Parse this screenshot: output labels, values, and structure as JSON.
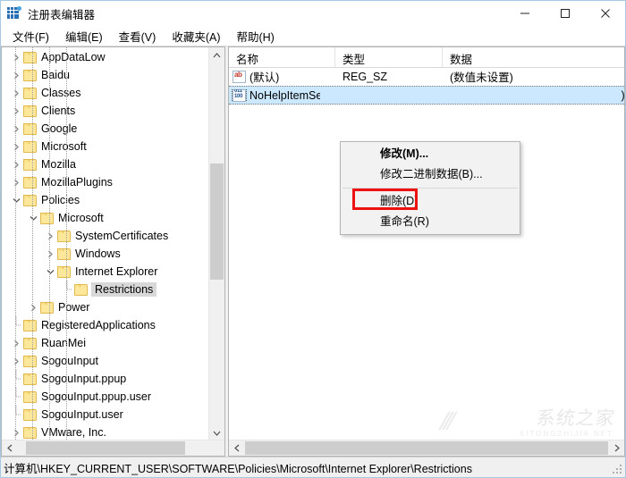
{
  "window": {
    "title": "注册表编辑器",
    "icon": "registry-editor-icon",
    "controls": {
      "minimize": "–",
      "maximize": "□",
      "close": "✕"
    }
  },
  "menubar": {
    "items": [
      {
        "label": "文件(F)",
        "name": "menu-file"
      },
      {
        "label": "编辑(E)",
        "name": "menu-edit"
      },
      {
        "label": "查看(V)",
        "name": "menu-view"
      },
      {
        "label": "收藏夹(A)",
        "name": "menu-favorites"
      },
      {
        "label": "帮助(H)",
        "name": "menu-help"
      }
    ]
  },
  "tree": {
    "items": [
      {
        "label": "AppDataLow",
        "indent": 1,
        "state": "collapsed",
        "selected": false
      },
      {
        "label": "Baidu",
        "indent": 1,
        "state": "collapsed",
        "selected": false
      },
      {
        "label": "Classes",
        "indent": 1,
        "state": "collapsed",
        "selected": false
      },
      {
        "label": "Clients",
        "indent": 1,
        "state": "collapsed",
        "selected": false
      },
      {
        "label": "Google",
        "indent": 1,
        "state": "collapsed",
        "selected": false
      },
      {
        "label": "Microsoft",
        "indent": 1,
        "state": "collapsed",
        "selected": false
      },
      {
        "label": "Mozilla",
        "indent": 1,
        "state": "collapsed",
        "selected": false
      },
      {
        "label": "MozillaPlugins",
        "indent": 1,
        "state": "collapsed",
        "selected": false
      },
      {
        "label": "Policies",
        "indent": 1,
        "state": "expanded",
        "selected": false
      },
      {
        "label": "Microsoft",
        "indent": 2,
        "state": "expanded",
        "selected": false
      },
      {
        "label": "SystemCertificates",
        "indent": 3,
        "state": "collapsed",
        "selected": false
      },
      {
        "label": "Windows",
        "indent": 3,
        "state": "collapsed",
        "selected": false
      },
      {
        "label": "Internet Explorer",
        "indent": 3,
        "state": "expanded",
        "selected": false
      },
      {
        "label": "Restrictions",
        "indent": 4,
        "state": "leaf",
        "selected": true
      },
      {
        "label": "Power",
        "indent": 2,
        "state": "collapsed",
        "selected": false
      },
      {
        "label": "RegisteredApplications",
        "indent": 1,
        "state": "leaf",
        "selected": false
      },
      {
        "label": "RuanMei",
        "indent": 1,
        "state": "collapsed",
        "selected": false
      },
      {
        "label": "SogouInput",
        "indent": 1,
        "state": "collapsed",
        "selected": false
      },
      {
        "label": "SogouInput.ppup",
        "indent": 1,
        "state": "leaf",
        "selected": false
      },
      {
        "label": "SogouInput.ppup.user",
        "indent": 1,
        "state": "leaf",
        "selected": false
      },
      {
        "label": "SogouInput.user",
        "indent": 1,
        "state": "leaf",
        "selected": false
      },
      {
        "label": "VMware, Inc.",
        "indent": 1,
        "state": "collapsed",
        "selected": false
      }
    ]
  },
  "list": {
    "columns": [
      {
        "label": "名称",
        "name": "column-name"
      },
      {
        "label": "类型",
        "name": "column-type"
      },
      {
        "label": "数据",
        "name": "column-data"
      }
    ],
    "rows": [
      {
        "name": "(默认)",
        "type": "REG_SZ",
        "data": "(数值未设置)",
        "icon": "string-value-icon",
        "selected": false
      },
      {
        "name": "NoHelpItemSe...",
        "type": "",
        "data": ")",
        "icon": "binary-value-icon",
        "selected": true
      }
    ]
  },
  "context_menu": {
    "items": [
      {
        "label": "修改(M)...",
        "name": "context-modify",
        "bold": true,
        "highlighted": false
      },
      {
        "label": "修改二进制数据(B)...",
        "name": "context-modify-binary",
        "bold": false,
        "highlighted": false
      },
      {
        "separator": true
      },
      {
        "label": "删除(D)",
        "name": "context-delete",
        "bold": false,
        "highlighted": true
      },
      {
        "label": "重命名(R)",
        "name": "context-rename",
        "bold": false,
        "highlighted": false
      }
    ],
    "highlight_color": "#ee1111"
  },
  "statusbar": {
    "path": "计算机\\HKEY_CURRENT_USER\\SOFTWARE\\Policies\\Microsoft\\Internet Explorer\\Restrictions"
  },
  "watermark": {
    "text": "系统之家",
    "subtext": "XITONGZHIJIA.NET"
  }
}
